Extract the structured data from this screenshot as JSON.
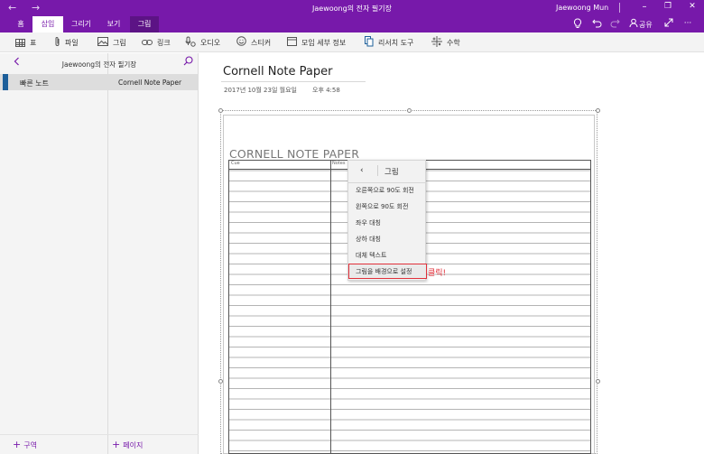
{
  "window": {
    "title": "Jaewoong의 전자 필기장",
    "user": "Jaewoong Mun",
    "back_arrow": "←",
    "forward_arrow": "→",
    "minimize": "–",
    "restore": "❐",
    "close": "✕"
  },
  "tabs": [
    {
      "label": "홈"
    },
    {
      "label": "삽입"
    },
    {
      "label": "그리기"
    },
    {
      "label": "보기"
    },
    {
      "label": "그림"
    }
  ],
  "tab_actions": {
    "share_label": "공유",
    "more": "···"
  },
  "ribbon": {
    "table": "표",
    "file": "파일",
    "picture": "그림",
    "link": "링크",
    "audio": "오디오",
    "sticker": "스티커",
    "meeting": "모임 세부 정보",
    "research": "리서치 도구",
    "math": "수학"
  },
  "navigation": {
    "notebook_name": "Jaewoong의 전자 필기장",
    "section": "빠른 노트",
    "page": "Cornell Note Paper",
    "add_section": "구역",
    "add_page": "페이지"
  },
  "page": {
    "title": "Cornell Note Paper",
    "date": "2017년 10월 23일 월요일",
    "time": "오후 4:58"
  },
  "paper": {
    "title": "CORNELL NOTE PAPER",
    "cue_label": "Cue",
    "notes_label": "Notes"
  },
  "context_menu": {
    "title": "그림",
    "back": "‹",
    "items": [
      "오른쪽으로 90도 회전",
      "왼쪽으로 90도 회전",
      "좌우 대칭",
      "상하 대칭",
      "대체 텍스트",
      "그림을 배경으로 설정"
    ],
    "highlighted_index": 5
  },
  "annotation": {
    "click_note": "클릭!"
  },
  "colors": {
    "accent": "#7719aa",
    "highlight": "#e0303a",
    "section_tab": "#1d5f9a"
  }
}
